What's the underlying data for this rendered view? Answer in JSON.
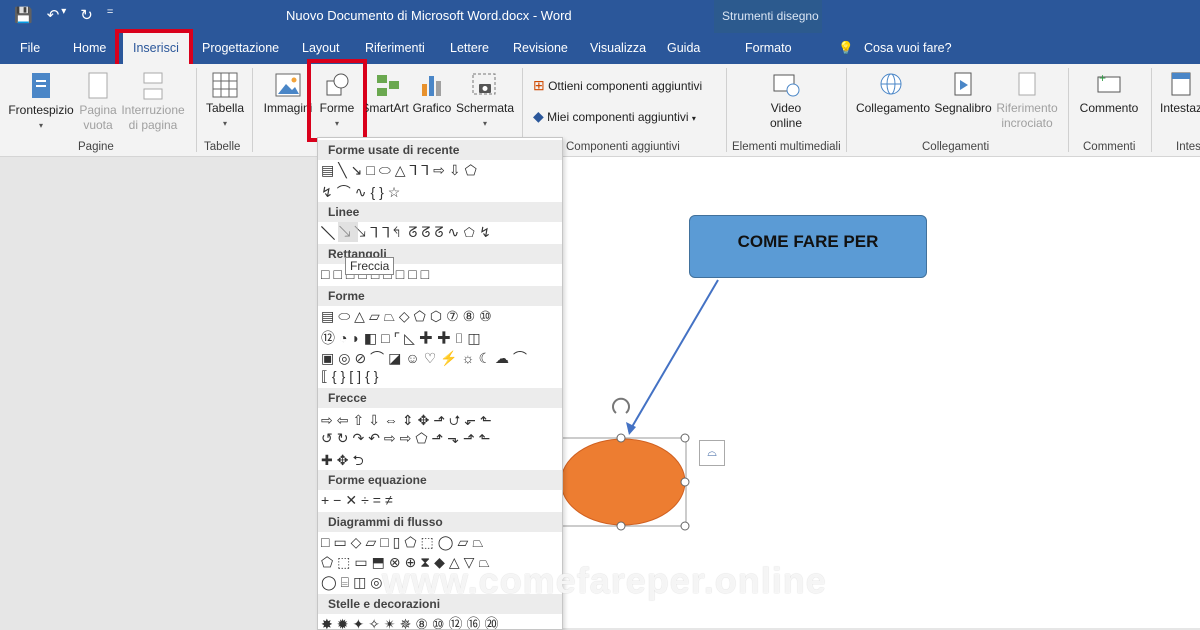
{
  "window": {
    "title": "Nuovo Documento di Microsoft Word.docx  -  Word",
    "context_group": "Strumenti disegno"
  },
  "qat": {
    "save": "💾",
    "undo": "↶",
    "undo_drop": "▾",
    "redo": "↻",
    "customize": "="
  },
  "tabs": [
    {
      "label": "File"
    },
    {
      "label": "Home"
    },
    {
      "label": "Inserisci",
      "active": true
    },
    {
      "label": "Progettazione"
    },
    {
      "label": "Layout"
    },
    {
      "label": "Riferimenti"
    },
    {
      "label": "Lettere"
    },
    {
      "label": "Revisione"
    },
    {
      "label": "Visualizza"
    },
    {
      "label": "Guida"
    },
    {
      "label": "Formato"
    },
    {
      "label": "Cosa vuoi fare?"
    }
  ],
  "ribbon": {
    "frontespizio": "Frontespizio",
    "pagina_vuota": "Pagina vuota",
    "interruzione": "Interruzione di pagina",
    "tabella": "Tabella",
    "immagini": "Immagini",
    "forme": "Forme",
    "smartart": "SmartArt",
    "grafico": "Grafico",
    "schermata": "Schermata",
    "ottieni": "Ottieni componenti aggiuntivi",
    "miei": "Miei componenti aggiuntivi",
    "video": "Video online",
    "collegamento": "Collegamento",
    "segnalibro": "Segnalibro",
    "riferimento": "Riferimento incrociato",
    "commento": "Commento",
    "intestazione": "Intestaz",
    "groups": {
      "pagine": "Pagine",
      "tabelle": "Tabelle",
      "componenti": "Componenti aggiuntivi",
      "multimediali": "Elementi multimediali",
      "collegamenti": "Collegamenti",
      "commenti": "Commenti",
      "intes": "Intes"
    }
  },
  "menu": {
    "sections": [
      "Forme usate di recente",
      "Linee",
      "Rettangoli",
      "Forme",
      "Frecce",
      "Forme equazione",
      "Diagrammi di flusso",
      "Stelle e decorazioni"
    ],
    "rows": {
      "recent1": "▤╲↘□⬭△⅂⅂⇨⇩⬠",
      "recent2": "↯⌒∿{}☆",
      "lines": "╲↘↘⅂⅂↰ᘔᘔᘔ∿⬠↯",
      "rects": "□□□□□□□□□",
      "forme1": "▤⬭△▱⏢◇⬠⬡⑦⑧⑩",
      "forme2": "⑫◔◗◧□⌜◺✚✚⌷◫",
      "forme3": "▣◎⊘⌒◪☺♡⚡☼☾☁⌒",
      "forme4": "⟦{}[]{}",
      "frecce1": "⇨⇦⇧⇩⇔⇕✥⬏⮍⬐⬑",
      "frecce2": "↺↻↷↶⇨⇨⬠⬏⬎⬏⬑",
      "frecce3": "✚✥⮌",
      "equaz": "+−✕÷=≠",
      "flusso1": "□▭◇▱□▯⬠⬚◯▱⏢",
      "flusso2": "⬠⬚▭⬒⊗⊕⧗◆△▽⏢",
      "flusso3": "◯⌸◫◎",
      "stelle": "✸✹✦✧✴✵⑧⑩⑫⑯⑳"
    }
  },
  "tooltip": "Freccia",
  "document": {
    "callout_text": "COME FARE PER"
  },
  "watermark": "www.comefareper.online",
  "colors": {
    "brand": "#2b579a",
    "highlight": "#d9001b",
    "callout": "#5b9bd5",
    "ellipse": "#ed7d31"
  }
}
